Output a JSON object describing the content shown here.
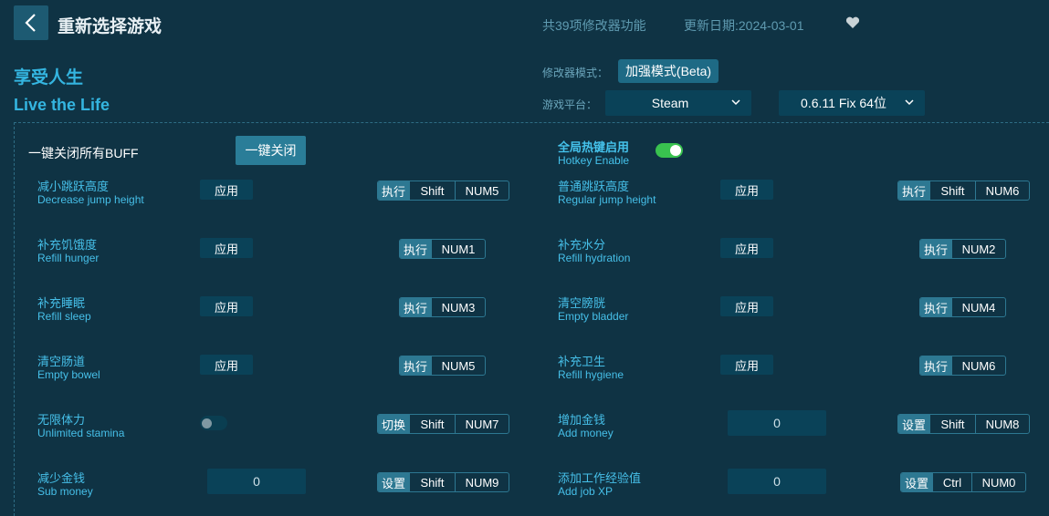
{
  "header": {
    "title": "重新选择游戏",
    "feature_count": "共39项修改器功能",
    "update_date": "更新日期:2024-03-01"
  },
  "game": {
    "name_cn": "享受人生",
    "name_en": "Live the Life"
  },
  "mode": {
    "label": "修改器模式：",
    "value": "加强模式(Beta)"
  },
  "platform": {
    "label": "游戏平台：",
    "value": "Steam",
    "version": "0.6.11 Fix 64位"
  },
  "global": {
    "close_all_label": "一键关闭所有BUFF",
    "close_all_button": "一键关闭",
    "hotkey_cn": "全局热键启用",
    "hotkey_en": "Hotkey Enable",
    "hotkey_enabled": true
  },
  "options": [
    {
      "cn": "减小跳跃高度",
      "en": "Decrease jump height",
      "control": "应用",
      "action": "执行",
      "keys": [
        "Shift",
        "NUM5"
      ]
    },
    {
      "cn": "普通跳跃高度",
      "en": "Regular jump height",
      "control": "应用",
      "action": "执行",
      "keys": [
        "Shift",
        "NUM6"
      ]
    },
    {
      "cn": "补充饥饿度",
      "en": "Refill hunger",
      "control": "应用",
      "action": "执行",
      "keys": [
        "NUM1"
      ]
    },
    {
      "cn": "补充水分",
      "en": "Refill hydration",
      "control": "应用",
      "action": "执行",
      "keys": [
        "NUM2"
      ]
    },
    {
      "cn": "补充睡眠",
      "en": "Refill sleep",
      "control": "应用",
      "action": "执行",
      "keys": [
        "NUM3"
      ]
    },
    {
      "cn": "清空膀胱",
      "en": "Empty bladder",
      "control": "应用",
      "action": "执行",
      "keys": [
        "NUM4"
      ]
    },
    {
      "cn": "清空肠道",
      "en": "Empty bowel",
      "control": "应用",
      "action": "执行",
      "keys": [
        "NUM5"
      ]
    },
    {
      "cn": "补充卫生",
      "en": "Refill hygiene",
      "control": "应用",
      "action": "执行",
      "keys": [
        "NUM6"
      ]
    },
    {
      "cn": "无限体力",
      "en": "Unlimited stamina",
      "control": "toggle",
      "action": "切换",
      "keys": [
        "Shift",
        "NUM7"
      ]
    },
    {
      "cn": "增加金钱",
      "en": "Add money",
      "control": "0",
      "action": "设置",
      "keys": [
        "Shift",
        "NUM8"
      ]
    },
    {
      "cn": "减少金钱",
      "en": "Sub money",
      "control": "0",
      "action": "设置",
      "keys": [
        "Shift",
        "NUM9"
      ]
    },
    {
      "cn": "添加工作经验值",
      "en": "Add job XP",
      "control": "0",
      "action": "设置",
      "keys": [
        "Ctrl",
        "NUM0"
      ]
    }
  ]
}
